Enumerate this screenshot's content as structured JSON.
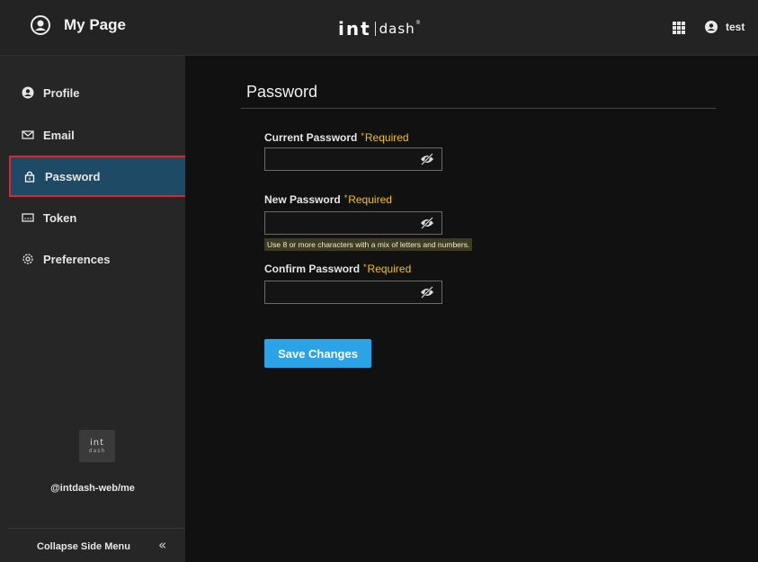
{
  "header": {
    "app_title": "My Page",
    "brand_int": "int",
    "brand_dash": "dash",
    "brand_mark": "®",
    "apps_icon": "grid-icon",
    "user_name": "test"
  },
  "sidebar": {
    "items": [
      {
        "label": "Profile",
        "icon": "user-circle-icon"
      },
      {
        "label": "Email",
        "icon": "envelope-icon"
      },
      {
        "label": "Password",
        "icon": "lock-icon",
        "active": true
      },
      {
        "label": "Token",
        "icon": "token-icon"
      },
      {
        "label": "Preferences",
        "icon": "gear-icon"
      }
    ],
    "logo_top": "int",
    "logo_bottom": "dash",
    "org": "@intdash-web/me",
    "collapse_label": "Collapse Side Menu",
    "collapse_icon": "«"
  },
  "main": {
    "title": "Password",
    "required_text": "Required",
    "required_star": "*",
    "fields": [
      {
        "label": "Current Password",
        "value": ""
      },
      {
        "label": "New Password",
        "value": ""
      },
      {
        "label": "Confirm Password",
        "value": ""
      }
    ],
    "hint": "Use 8 or more characters with a mix of letters and numbers.",
    "save_label": "Save Changes"
  },
  "colors": {
    "accent": "#2ba3e6",
    "active_nav": "#1f4a66",
    "required": "#f5c400",
    "highlight_border": "#e4222b"
  }
}
